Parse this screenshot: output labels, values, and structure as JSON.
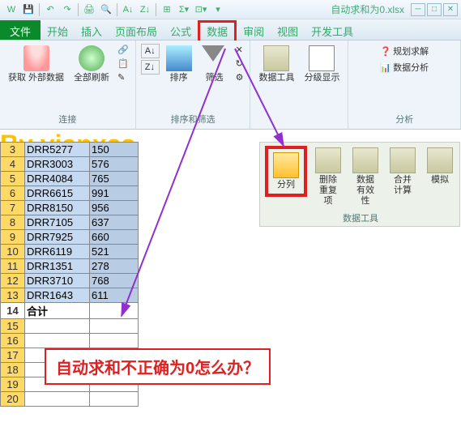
{
  "title": "自动求和为0.xlsx",
  "qat": [
    "save",
    "undo",
    "redo",
    "print",
    "preview",
    "sort-asc",
    "sort-desc",
    "table",
    "sum",
    "more"
  ],
  "tabs": {
    "file": "文件",
    "items": [
      "开始",
      "插入",
      "页面布局",
      "公式",
      "数据",
      "审阅",
      "视图",
      "开发工具"
    ],
    "highlighted": "数据"
  },
  "ribbon": {
    "groups": [
      {
        "label": "连接",
        "buttons": [
          {
            "label": "获取\n外部数据",
            "icon": "db",
            "big": true,
            "sub": true
          },
          {
            "label": "全部刷新",
            "icon": "refresh",
            "big": true,
            "sub": true
          }
        ],
        "side": [
          {
            "icon": "link"
          },
          {
            "icon": "props"
          },
          {
            "icon": "edit"
          }
        ]
      },
      {
        "label": "排序和筛选",
        "buttons": [
          {
            "label": "",
            "icon": "az",
            "small": true
          },
          {
            "label": "",
            "icon": "za",
            "small": true
          },
          {
            "label": "排序",
            "icon": "sort",
            "big": true
          },
          {
            "label": "筛选",
            "icon": "funnel",
            "big": true
          }
        ],
        "side": [
          {
            "icon": "clear"
          },
          {
            "icon": "reapply"
          },
          {
            "icon": "adv"
          }
        ]
      },
      {
        "label": "",
        "buttons": [
          {
            "label": "数据工具",
            "icon": "tools",
            "big": true,
            "sub": true
          },
          {
            "label": "分级显示",
            "icon": "outline",
            "big": true,
            "sub": true
          }
        ]
      },
      {
        "label": "分析",
        "side_items": [
          {
            "icon": "solver",
            "label": "规划求解"
          },
          {
            "icon": "analysis",
            "label": "数据分析"
          }
        ]
      }
    ]
  },
  "ribbon2": {
    "group_label": "数据工具",
    "buttons": [
      {
        "label": "分列",
        "icon": "split",
        "highlight": true
      },
      {
        "label": "删除\n重复项",
        "icon": "dedup"
      },
      {
        "label": "数据\n有效性",
        "icon": "valid",
        "sub": true
      },
      {
        "label": "合并计算",
        "icon": "consol"
      },
      {
        "label": "模拟",
        "icon": "whatif"
      }
    ]
  },
  "sheet": {
    "rows": [
      {
        "n": 3,
        "a": "DRR5277",
        "b": "150"
      },
      {
        "n": 4,
        "a": "DRR3003",
        "b": "576"
      },
      {
        "n": 5,
        "a": "DRR4084",
        "b": "765"
      },
      {
        "n": 6,
        "a": "DRR6615",
        "b": "991"
      },
      {
        "n": 7,
        "a": "DRR8150",
        "b": "956"
      },
      {
        "n": 8,
        "a": "DRR7105",
        "b": "637"
      },
      {
        "n": 9,
        "a": "DRR7925",
        "b": "660"
      },
      {
        "n": 10,
        "a": "DRR6119",
        "b": "521"
      },
      {
        "n": 11,
        "a": "DRR1351",
        "b": "278"
      },
      {
        "n": 12,
        "a": "DRR3710",
        "b": "768"
      },
      {
        "n": 13,
        "a": "DRR1643",
        "b": "611"
      }
    ],
    "total_row": {
      "n": 14,
      "a": "合计",
      "b": ""
    },
    "blank_rows": [
      15,
      16,
      17,
      18,
      19,
      20
    ]
  },
  "annotations": {
    "line1": "自动求和不正确为0怎么办？",
    "line2": "By yianxss"
  }
}
